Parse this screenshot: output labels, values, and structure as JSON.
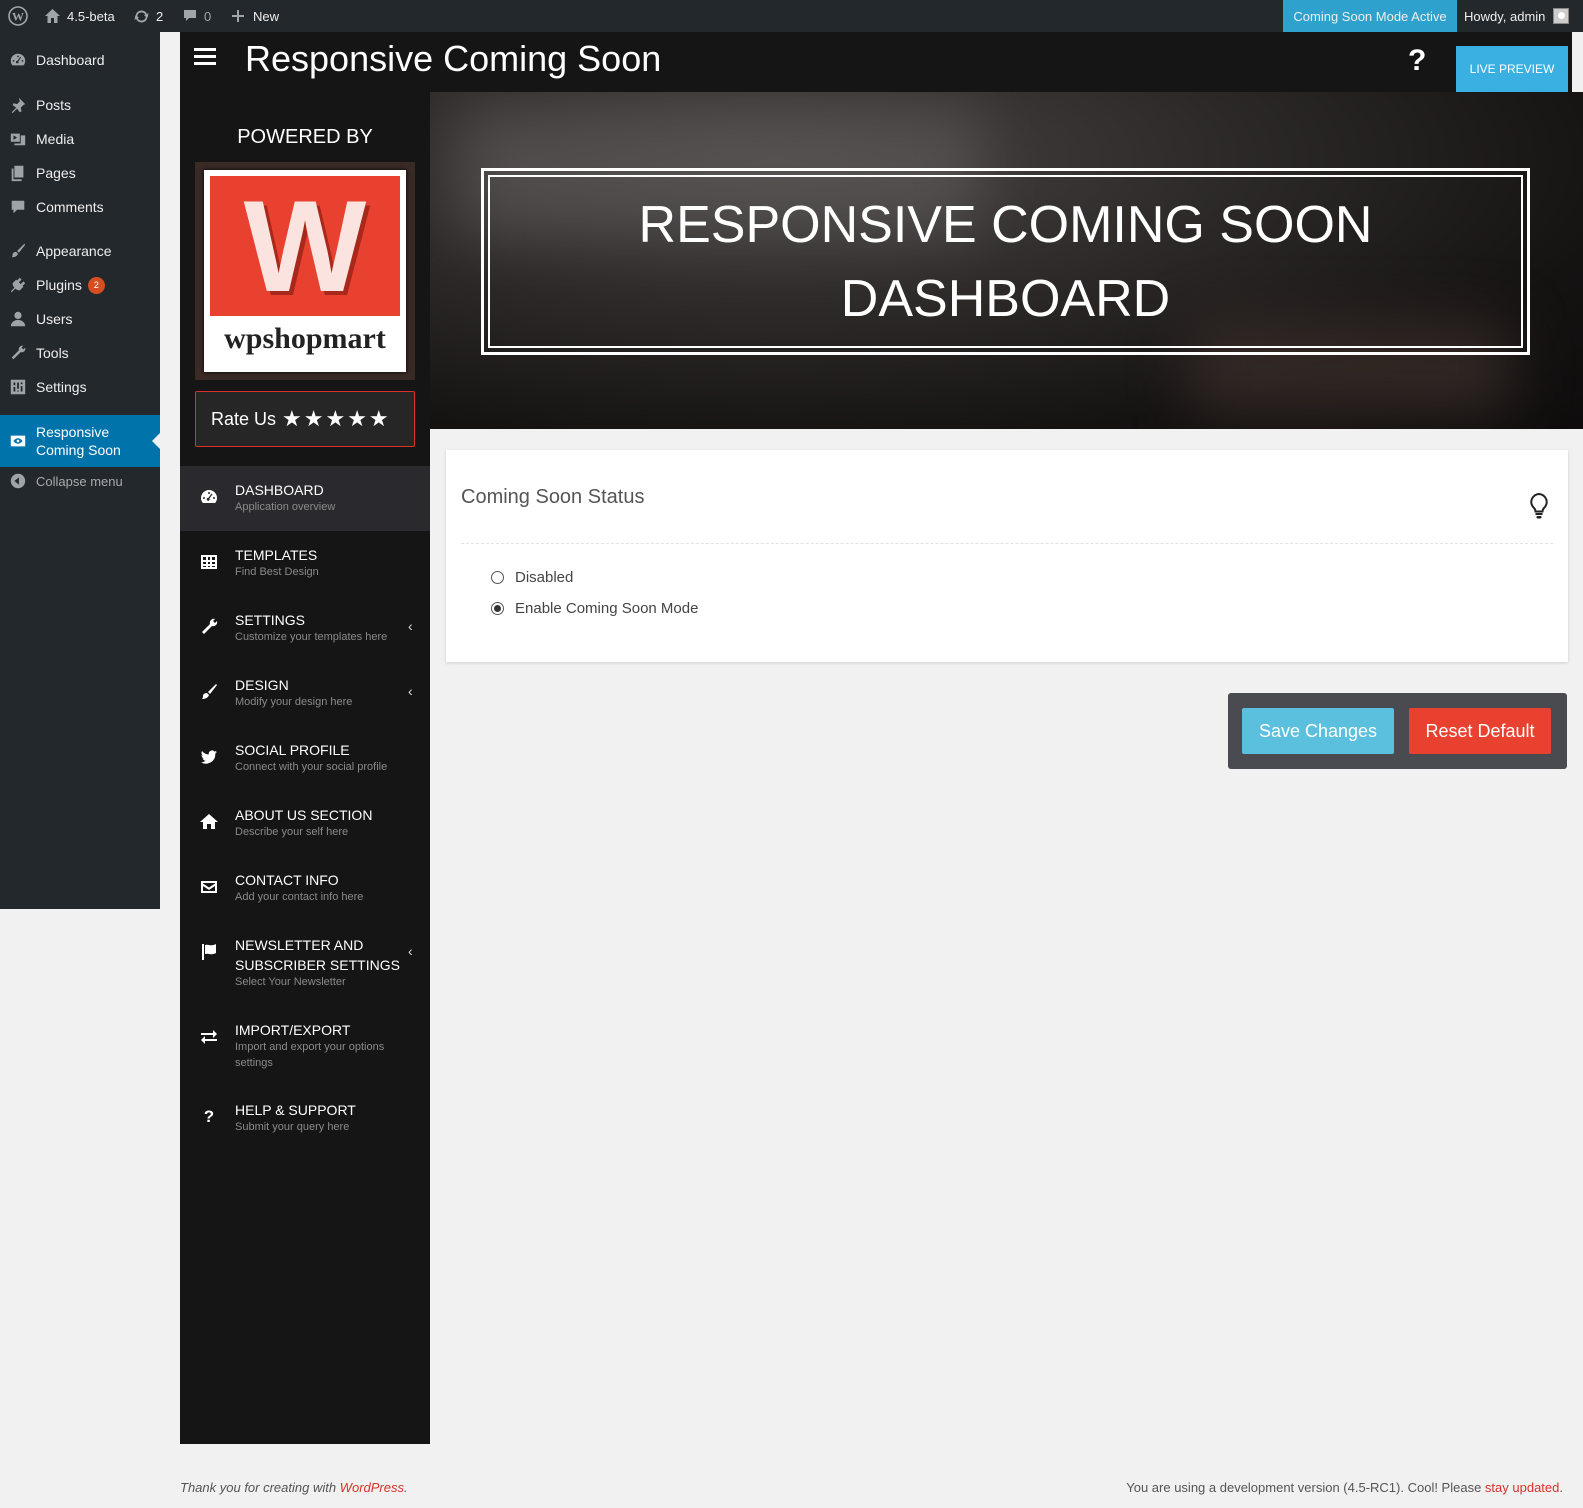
{
  "adminbar": {
    "site_name": "4.5-beta",
    "updates_count": "2",
    "comments_count": "0",
    "new_label": "New",
    "coming_soon_status": "Coming Soon Mode Active",
    "account_greeting": "Howdy, admin"
  },
  "wp_menu": {
    "dashboard": "Dashboard",
    "posts": "Posts",
    "media": "Media",
    "pages": "Pages",
    "comments": "Comments",
    "appearance": "Appearance",
    "plugins": "Plugins",
    "plugins_badge": "2",
    "users": "Users",
    "tools": "Tools",
    "settings": "Settings",
    "current_line1": "Responsive",
    "current_line2": "Coming Soon",
    "collapse": "Collapse menu"
  },
  "plugin_header": {
    "title": "Responsive Coming Soon",
    "help_icon": "?",
    "live_preview": "LIVE PREVIEW"
  },
  "plugin_sidebar": {
    "powered_by": "POWERED BY",
    "logo_letter": "W",
    "logo_text": "wpshopmart",
    "rate_us": "Rate Us",
    "rate_stars": "★★★★★",
    "nav": [
      {
        "title": "DASHBOARD",
        "subtitle": "Application overview"
      },
      {
        "title": "TEMPLATES",
        "subtitle": "Find Best Design"
      },
      {
        "title": "SETTINGS",
        "subtitle": "Customize your templates here"
      },
      {
        "title": "DESIGN",
        "subtitle": "Modify your design here"
      },
      {
        "title": "SOCIAL PROFILE",
        "subtitle": "Connect with your social profile"
      },
      {
        "title": "ABOUT US SECTION",
        "subtitle": "Describe your self here"
      },
      {
        "title": "CONTACT INFO",
        "subtitle": "Add your contact info here"
      },
      {
        "title": "NEWSLETTER AND SUBSCRIBER SETTINGS",
        "subtitle": "Select Your Newsletter"
      },
      {
        "title": "IMPORT/EXPORT",
        "subtitle": "Import and export your options settings"
      },
      {
        "title": "HELP & SUPPORT",
        "subtitle": "Submit your query here"
      }
    ]
  },
  "hero": {
    "line1": "RESPONSIVE COMING SOON",
    "line2": "DASHBOARD"
  },
  "status": {
    "title": "Coming Soon Status",
    "option_disabled": "Disabled",
    "option_enabled": "Enable Coming Soon Mode",
    "selected": "Enable Coming Soon Mode"
  },
  "actions": {
    "save": "Save Changes",
    "reset": "Reset Default"
  },
  "footer": {
    "left_prefix": "Thank you for creating with ",
    "left_link": "WordPress",
    "left_suffix": ".",
    "right_prefix": "You are using a development version (4.5-RC1). Cool! Please ",
    "right_link": "stay updated",
    "right_suffix": "."
  },
  "colors": {
    "accent_blue": "#0073aa",
    "status_blue": "#2ea2cc",
    "save_blue": "#5bc0de",
    "reset_red": "#e8412f",
    "dark_bg": "#151515"
  }
}
